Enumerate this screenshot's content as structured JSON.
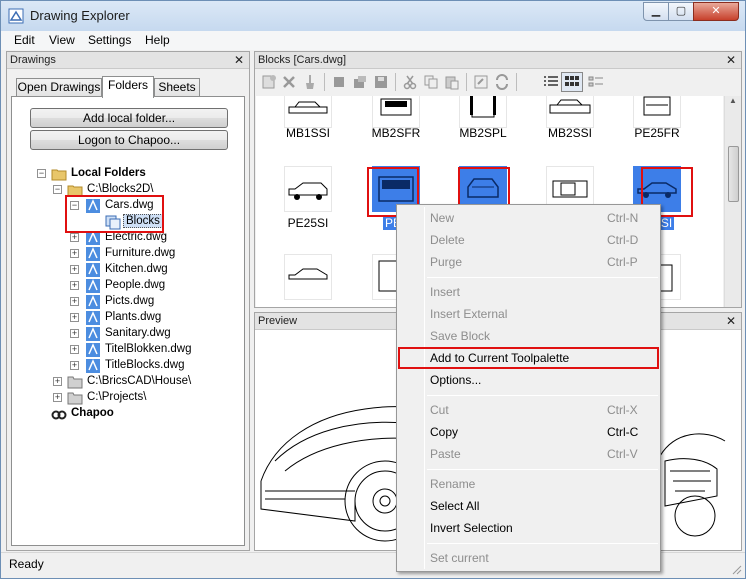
{
  "window": {
    "title": "Drawing Explorer",
    "controls": {
      "minimize": "▁",
      "maximize": "▢",
      "close": "✕"
    }
  },
  "menu": [
    "Edit",
    "View",
    "Settings",
    "Help"
  ],
  "left_panel": {
    "title": "Drawings",
    "close": "✕",
    "tabs": [
      "Open Drawings",
      "Folders",
      "Sheets"
    ],
    "active_tab": "Folders",
    "buttons": {
      "add_local_folder": "Add local folder...",
      "logon": "Logon to Chapoo..."
    },
    "tree": {
      "local_folders": "Local Folders",
      "blocks2d": "C:\\Blocks2D\\",
      "cars": "Cars.dwg",
      "blocks": "Blocks",
      "files": [
        "Electric.dwg",
        "Furniture.dwg",
        "Kitchen.dwg",
        "People.dwg",
        "Picts.dwg",
        "Plants.dwg",
        "Sanitary.dwg",
        "TitelBlokken.dwg",
        "TitleBlocks.dwg"
      ],
      "bricscad_house": "C:\\BricsCAD\\House\\",
      "projects": "C:\\Projects\\",
      "chapoo": "Chapoo"
    }
  },
  "blocks_panel": {
    "title": "Blocks [Cars.dwg]",
    "close": "✕",
    "row1": [
      "MB1SSI",
      "MB2SFR",
      "MB2SPL",
      "MB2SSI",
      "PE25FR"
    ],
    "row2": [
      "PE25SI",
      "PEJ",
      "",
      "",
      "911SI"
    ]
  },
  "preview_panel": {
    "title": "Preview",
    "close": "✕"
  },
  "context_menu": {
    "items": [
      {
        "label": "New",
        "shortcut": "Ctrl-N",
        "disabled": true
      },
      {
        "label": "Delete",
        "shortcut": "Ctrl-D",
        "disabled": true
      },
      {
        "label": "Purge",
        "shortcut": "Ctrl-P",
        "disabled": true
      },
      {
        "label": "Insert",
        "shortcut": "",
        "disabled": true
      },
      {
        "label": "Insert External",
        "shortcut": "",
        "disabled": true
      },
      {
        "label": "Save Block",
        "shortcut": "",
        "disabled": true
      },
      {
        "label": "Add to Current Toolpalette",
        "shortcut": "",
        "disabled": false
      },
      {
        "label": "Options...",
        "shortcut": "",
        "disabled": false
      },
      {
        "label": "Cut",
        "shortcut": "Ctrl-X",
        "disabled": true
      },
      {
        "label": "Copy",
        "shortcut": "Ctrl-C",
        "disabled": false
      },
      {
        "label": "Paste",
        "shortcut": "Ctrl-V",
        "disabled": true
      },
      {
        "label": "Rename",
        "shortcut": "",
        "disabled": true
      },
      {
        "label": "Select All",
        "shortcut": "",
        "disabled": false
      },
      {
        "label": "Invert Selection",
        "shortcut": "",
        "disabled": false
      },
      {
        "label": "Set current",
        "shortcut": "",
        "disabled": true
      }
    ]
  },
  "status": {
    "text": "Ready"
  },
  "colors": {
    "highlight_red": "#e01010",
    "selection_blue": "#3d7ee8"
  }
}
